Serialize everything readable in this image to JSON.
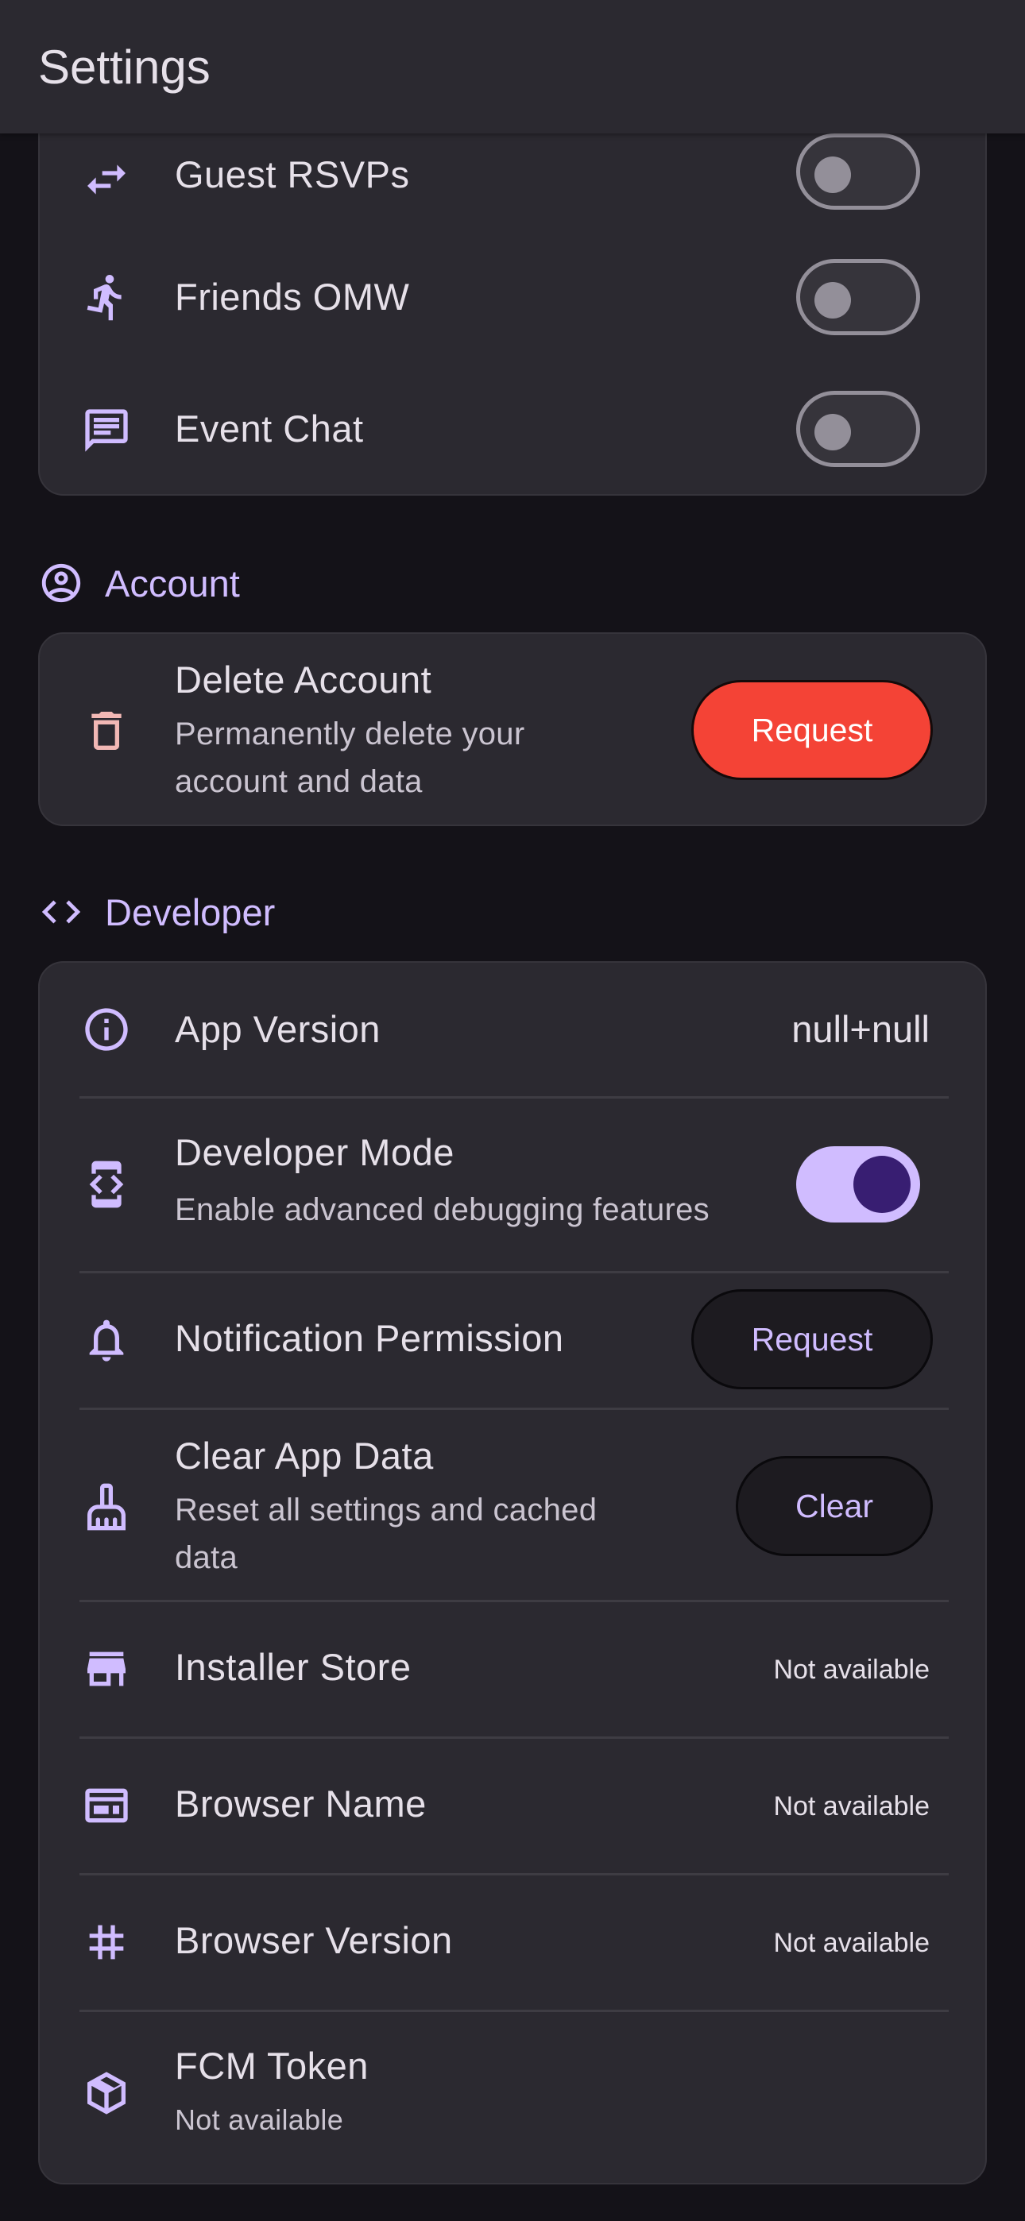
{
  "app_bar": {
    "title": "Settings"
  },
  "notifications_card": {
    "rows": [
      {
        "label": "Guest RSVPs",
        "icon": "swap-icon",
        "enabled": false
      },
      {
        "label": "Friends OMW",
        "icon": "running-person-icon",
        "enabled": false
      },
      {
        "label": "Event Chat",
        "icon": "chat-icon",
        "enabled": false
      }
    ]
  },
  "account": {
    "section_title": "Account",
    "delete": {
      "label": "Delete Account",
      "description": "Permanently delete your account and data",
      "button": "Request"
    }
  },
  "developer": {
    "section_title": "Developer",
    "app_version": {
      "label": "App Version",
      "value": "null+null"
    },
    "developer_mode": {
      "label": "Developer Mode",
      "description": "Enable advanced debugging features",
      "enabled": true
    },
    "notification_permission": {
      "label": "Notification Permission",
      "button": "Request"
    },
    "clear_data": {
      "label": "Clear App Data",
      "description": "Reset all settings and cached data",
      "button": "Clear"
    },
    "installer_store": {
      "label": "Installer Store",
      "value": "Not available"
    },
    "browser_name": {
      "label": "Browser Name",
      "value": "Not available"
    },
    "browser_version": {
      "label": "Browser Version",
      "value": "Not available"
    },
    "fcm_token": {
      "label": "FCM Token",
      "value": "Not available"
    }
  },
  "colors": {
    "background": "#141218",
    "surface": "#2B2930",
    "accent": "#D0BCFF",
    "danger": "#F44336",
    "danger_icon": "#F2B8B5"
  }
}
